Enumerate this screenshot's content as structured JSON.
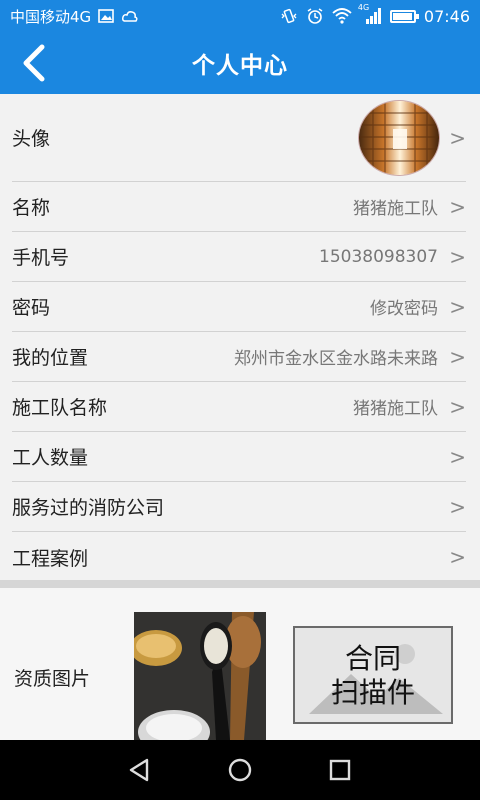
{
  "status_bar": {
    "carrier": "中国移动4G",
    "network": "4G",
    "time": "07:46",
    "battery_level": 0.85,
    "icons": [
      "gallery-icon",
      "cloud-icon",
      "vibrate-icon",
      "alarm-icon",
      "wifi-icon",
      "signal-icon",
      "battery-icon"
    ]
  },
  "header": {
    "title": "个人中心",
    "back_icon": "chevron-left-icon"
  },
  "profile": {
    "avatar_label": "头像",
    "rows": [
      {
        "label": "名称",
        "value": "猪猪施工队"
      },
      {
        "label": "手机号",
        "value": "15038098307"
      },
      {
        "label": "密码",
        "value": "修改密码"
      },
      {
        "label": "我的位置",
        "value": "郑州市金水区金水路未来路"
      },
      {
        "label": "施工队名称",
        "value": "猪猪施工队"
      },
      {
        "label": "工人数量",
        "value": ""
      },
      {
        "label": "服务过的消防公司",
        "value": ""
      },
      {
        "label": "工程案例",
        "value": ""
      }
    ],
    "chevron": ">"
  },
  "qualification": {
    "label": "资质图片",
    "scan_placeholder_line1": "合同",
    "scan_placeholder_line2": "扫描件"
  },
  "colors": {
    "accent": "#1b87e0",
    "background": "#f2f2f2",
    "label_text": "#222222",
    "value_text": "#777777"
  }
}
